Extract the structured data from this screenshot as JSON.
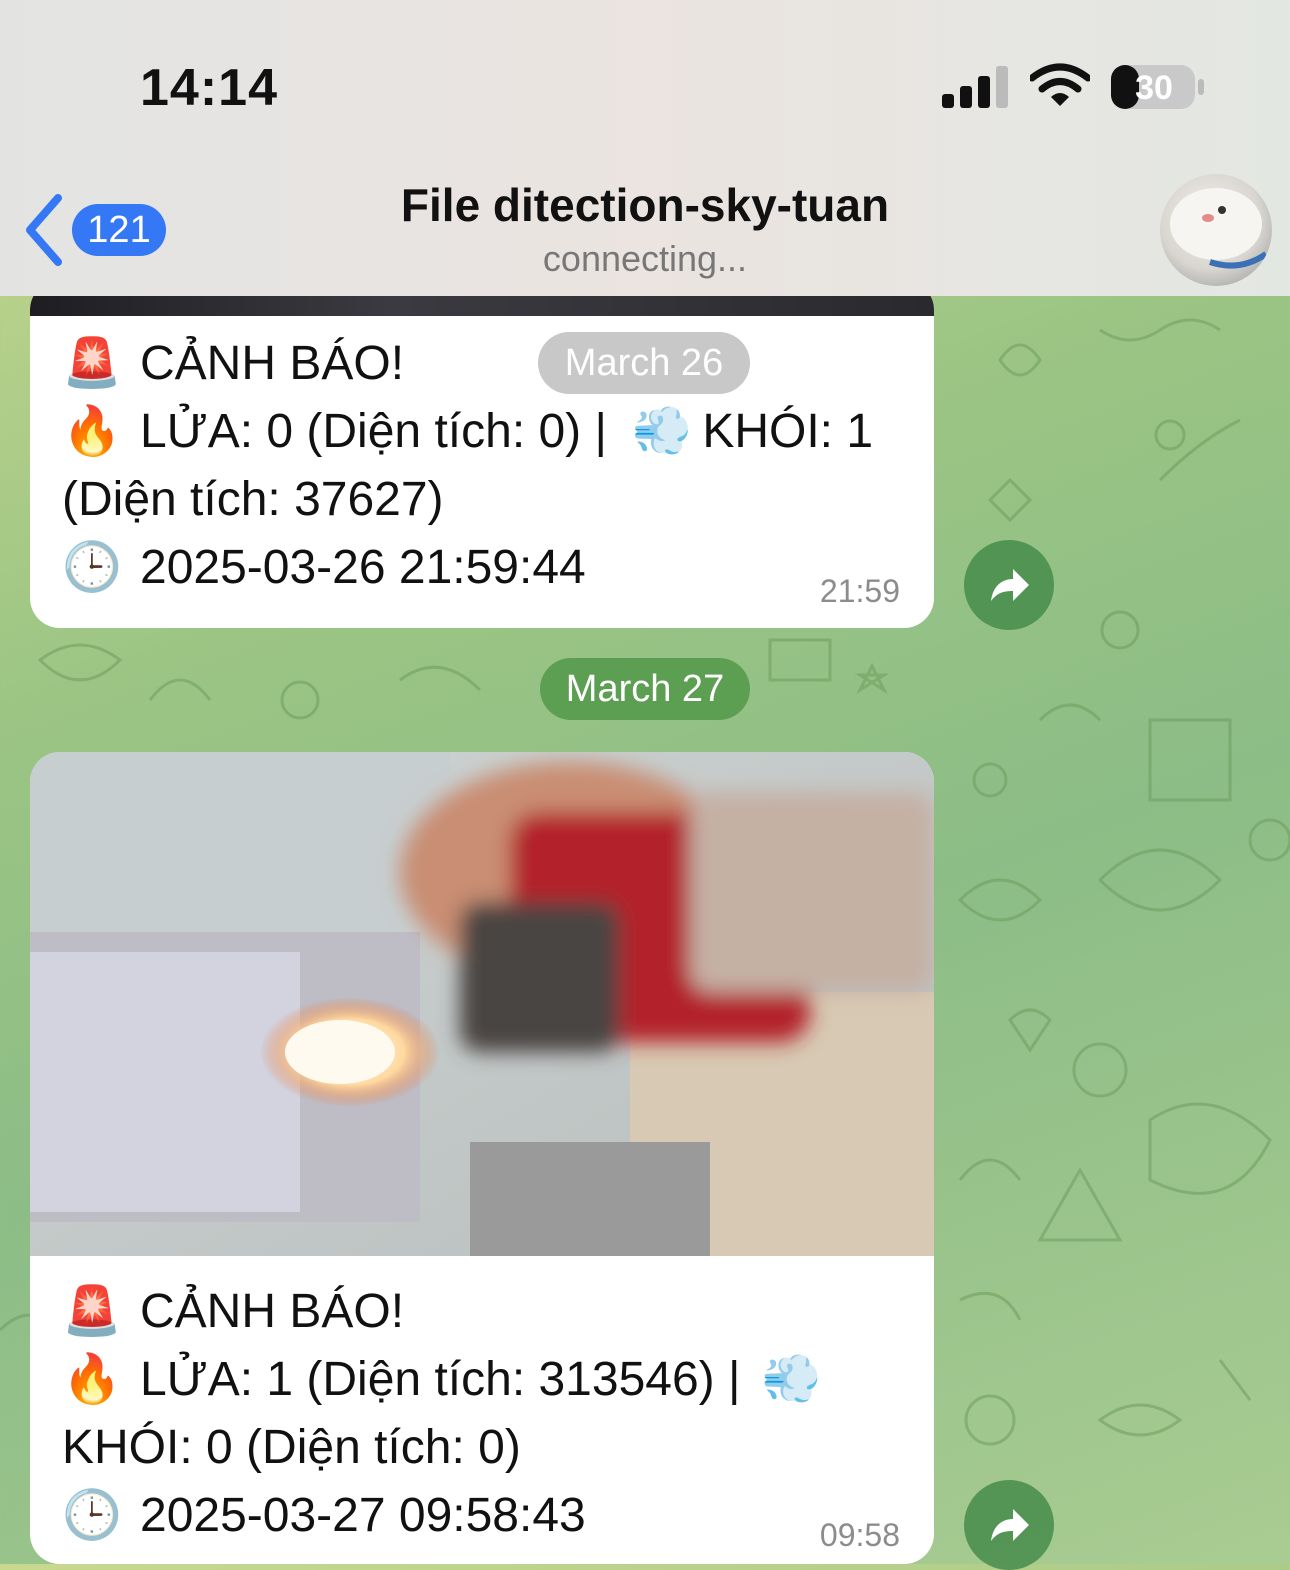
{
  "status_bar": {
    "time": "14:14",
    "battery": "30"
  },
  "header": {
    "back_count": "121",
    "title": "File ditection-sky-tuan",
    "status": "connecting..."
  },
  "floating_date": "March 26",
  "date_divider": "March 27",
  "messages": [
    {
      "alert": "CẢNH BÁO!",
      "detail_a": "LỬA: 0 (Diện tích: 0) |",
      "detail_b": "KHÓI: 1",
      "detail_c": "(Diện tích: 37627)",
      "timestamp": "2025-03-26 21:59:44",
      "time": "21:59"
    },
    {
      "alert": "CẢNH BÁO!",
      "detail_a": "LỬA: 1 (Diện tích: 313546) |",
      "detail_b": "",
      "detail_c": "KHÓI: 0 (Diện tích: 0)",
      "timestamp": "2025-03-27 09:58:43",
      "time": "09:58"
    }
  ],
  "colors": {
    "accent": "#3478f6",
    "forward": "#4e9a51",
    "date_pill_green": "#5d9f52",
    "date_pill_grey": "#c9c9c9"
  }
}
